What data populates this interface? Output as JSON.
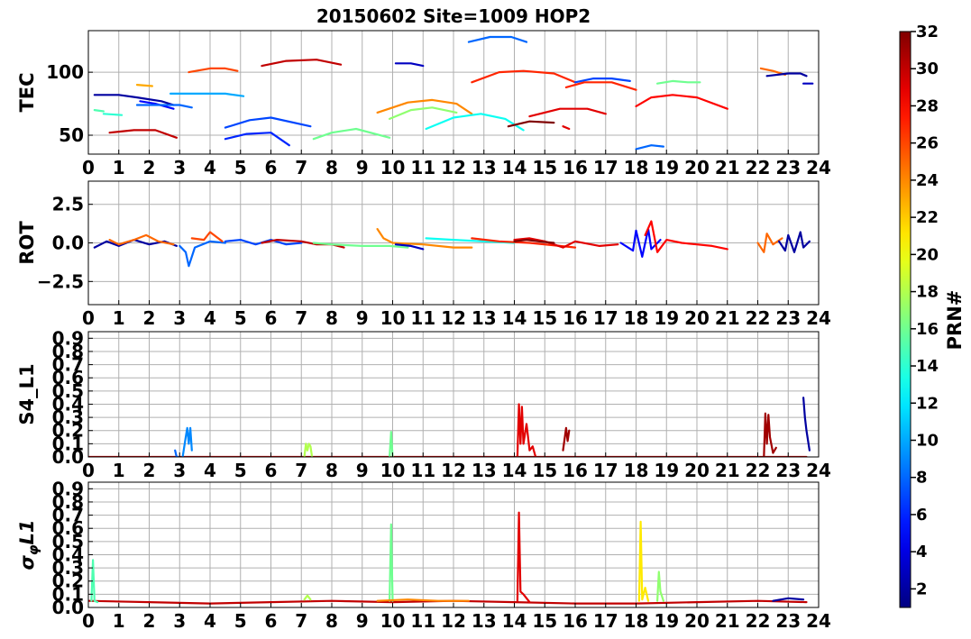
{
  "figure": {
    "title": "20150602 Site=1009 HOP2"
  },
  "colorbar": {
    "label": "PRN#",
    "ticks": [
      "2",
      "4",
      "6",
      "8",
      "10",
      "12",
      "14",
      "16",
      "18",
      "20",
      "22",
      "24",
      "26",
      "28",
      "30",
      "32"
    ],
    "range": [
      1,
      32
    ],
    "colormap": "jet"
  },
  "chart_data": [
    {
      "type": "line",
      "ylabel": "TEC",
      "xlim": [
        0,
        24
      ],
      "ylim": [
        35,
        133
      ],
      "xticks": [
        0,
        1,
        2,
        3,
        4,
        5,
        6,
        7,
        8,
        9,
        10,
        11,
        12,
        13,
        14,
        15,
        16,
        17,
        18,
        19,
        20,
        21,
        22,
        23,
        24
      ],
      "yticks": [
        50,
        100
      ],
      "grid": true,
      "series": [
        {
          "prn": 2,
          "x": [
            0.2,
            1.0,
            1.6,
            2.4,
            2.8
          ],
          "y": [
            82,
            82,
            80,
            77,
            74
          ]
        },
        {
          "prn": 5,
          "x": [
            1.7,
            2.2,
            2.8
          ],
          "y": [
            77,
            75,
            71
          ]
        },
        {
          "prn": 8,
          "x": [
            1.6,
            2.5,
            3.0,
            3.4
          ],
          "y": [
            74,
            74,
            74,
            72
          ]
        },
        {
          "prn": 10,
          "x": [
            2.7,
            3.2,
            4.5,
            5.1
          ],
          "y": [
            83,
            83,
            83,
            81
          ]
        },
        {
          "prn": 15,
          "x": [
            0.2,
            0.5
          ],
          "y": [
            70,
            69
          ]
        },
        {
          "prn": 14,
          "x": [
            0.5,
            1.1
          ],
          "y": [
            67,
            66
          ]
        },
        {
          "prn": 30,
          "x": [
            0.7,
            1.5,
            2.2,
            2.9
          ],
          "y": [
            52,
            54,
            54,
            48
          ]
        },
        {
          "prn": 23,
          "x": [
            1.6,
            2.1
          ],
          "y": [
            90,
            89
          ]
        },
        {
          "prn": 26,
          "x": [
            3.3,
            4.0,
            4.5,
            4.9
          ],
          "y": [
            100,
            103,
            103,
            101
          ]
        },
        {
          "prn": 7,
          "x": [
            4.5,
            5.3,
            6.0,
            7.3
          ],
          "y": [
            56,
            62,
            64,
            57
          ]
        },
        {
          "prn": 6,
          "x": [
            4.5,
            5.2,
            6.0,
            6.6
          ],
          "y": [
            47,
            51,
            52,
            42
          ]
        },
        {
          "prn": 30,
          "x": [
            5.7,
            6.5,
            7.5,
            8.3
          ],
          "y": [
            105,
            109,
            110,
            106
          ]
        },
        {
          "prn": 16,
          "x": [
            7.4,
            8.0,
            8.8,
            9.9
          ],
          "y": [
            47,
            52,
            55,
            48
          ]
        },
        {
          "prn": 3,
          "x": [
            10.1,
            10.6,
            11.0
          ],
          "y": [
            107,
            107,
            105
          ]
        },
        {
          "prn": 24,
          "x": [
            9.5,
            10.5,
            11.3,
            12.1,
            12.6
          ],
          "y": [
            68,
            76,
            78,
            75,
            67
          ]
        },
        {
          "prn": 17,
          "x": [
            9.9,
            10.6,
            11.3,
            12.1
          ],
          "y": [
            63,
            70,
            72,
            68
          ]
        },
        {
          "prn": 13,
          "x": [
            11.1,
            12.0,
            12.9,
            13.7,
            14.3
          ],
          "y": [
            55,
            64,
            67,
            63,
            54
          ]
        },
        {
          "prn": 8,
          "x": [
            12.5,
            13.2,
            13.9,
            14.4
          ],
          "y": [
            124,
            128,
            128,
            124
          ]
        },
        {
          "prn": 27,
          "x": [
            12.6,
            13.5,
            14.3,
            15.3,
            16.0
          ],
          "y": [
            92,
            100,
            101,
            99,
            92
          ]
        },
        {
          "prn": 32,
          "x": [
            13.8,
            14.5,
            15.3
          ],
          "y": [
            57,
            61,
            60
          ]
        },
        {
          "prn": 29,
          "x": [
            14.5,
            15.5,
            16.4,
            17.0
          ],
          "y": [
            65,
            71,
            71,
            67
          ]
        },
        {
          "prn": 29,
          "x": [
            15.6,
            15.8
          ],
          "y": [
            57,
            55
          ]
        },
        {
          "prn": 7,
          "x": [
            16.0,
            16.6,
            17.2,
            17.8
          ],
          "y": [
            92,
            95,
            95,
            93
          ]
        },
        {
          "prn": 27,
          "x": [
            15.7,
            16.3,
            17.2,
            18.0
          ],
          "y": [
            88,
            92,
            92,
            86
          ]
        },
        {
          "prn": 28,
          "x": [
            18.0,
            18.5,
            19.2,
            20.0,
            21.0
          ],
          "y": [
            73,
            80,
            82,
            80,
            71
          ]
        },
        {
          "prn": 8,
          "x": [
            18.0,
            18.5,
            18.9
          ],
          "y": [
            39,
            42,
            41
          ]
        },
        {
          "prn": 16,
          "x": [
            18.7,
            19.2,
            19.7,
            20.1
          ],
          "y": [
            91,
            93,
            92,
            92
          ]
        },
        {
          "prn": 25,
          "x": [
            22.1,
            22.5,
            22.9
          ],
          "y": [
            103,
            101,
            98
          ]
        },
        {
          "prn": 2,
          "x": [
            22.3,
            23.0,
            23.4,
            23.6
          ],
          "y": [
            97,
            99,
            99,
            97
          ]
        },
        {
          "prn": 3,
          "x": [
            23.5,
            23.8
          ],
          "y": [
            91,
            91
          ]
        }
      ]
    },
    {
      "type": "line",
      "ylabel": "ROT",
      "xlim": [
        0,
        24
      ],
      "ylim": [
        -4,
        4
      ],
      "xticks": [
        0,
        1,
        2,
        3,
        4,
        5,
        6,
        7,
        8,
        9,
        10,
        11,
        12,
        13,
        14,
        15,
        16,
        17,
        18,
        19,
        20,
        21,
        22,
        23,
        24
      ],
      "yticks": [
        -2.5,
        0.0,
        2.5
      ],
      "grid": true,
      "series": [
        {
          "prn": 2,
          "x": [
            0.2,
            0.6,
            1.0,
            1.5,
            2.0,
            2.5,
            2.9
          ],
          "y": [
            -0.3,
            0.1,
            -0.2,
            0.2,
            -0.1,
            0.1,
            -0.2
          ]
        },
        {
          "prn": 25,
          "x": [
            0.7,
            1.0,
            1.5,
            1.9,
            2.3,
            2.8
          ],
          "y": [
            0.2,
            -0.1,
            0.2,
            0.5,
            0.1,
            -0.1
          ]
        },
        {
          "prn": 8,
          "x": [
            3.0,
            3.2,
            3.3,
            3.5,
            4.0,
            4.5
          ],
          "y": [
            -0.2,
            -0.6,
            -1.5,
            -0.3,
            0.1,
            0.0
          ]
        },
        {
          "prn": 26,
          "x": [
            3.4,
            3.8,
            4.0,
            4.4
          ],
          "y": [
            0.3,
            0.2,
            0.7,
            0.1
          ]
        },
        {
          "prn": 7,
          "x": [
            4.5,
            5.0,
            5.5,
            6.0,
            6.5,
            7.0
          ],
          "y": [
            0.1,
            0.2,
            -0.1,
            0.2,
            -0.1,
            0.0
          ]
        },
        {
          "prn": 30,
          "x": [
            5.7,
            6.2,
            7.0,
            7.5,
            8.0,
            8.4
          ],
          "y": [
            0.0,
            0.2,
            0.1,
            -0.1,
            -0.1,
            -0.3
          ]
        },
        {
          "prn": 16,
          "x": [
            7.4,
            8.0,
            9.0,
            9.9,
            10.5
          ],
          "y": [
            0.0,
            -0.1,
            -0.2,
            -0.2,
            -0.3
          ]
        },
        {
          "prn": 24,
          "x": [
            9.5,
            9.7,
            10.0,
            11.0,
            12.0,
            12.6
          ],
          "y": [
            0.9,
            0.3,
            0.0,
            -0.1,
            -0.3,
            -0.3
          ]
        },
        {
          "prn": 3,
          "x": [
            10.1,
            10.6,
            11.0
          ],
          "y": [
            -0.1,
            -0.2,
            -0.4
          ]
        },
        {
          "prn": 13,
          "x": [
            11.1,
            12.0,
            13.0,
            14.0
          ],
          "y": [
            0.3,
            0.2,
            0.1,
            0.0
          ]
        },
        {
          "prn": 27,
          "x": [
            12.6,
            13.5,
            14.5,
            15.5,
            16.0
          ],
          "y": [
            0.3,
            0.1,
            0.0,
            -0.2,
            -0.3
          ]
        },
        {
          "prn": 29,
          "x": [
            14.0,
            14.5,
            15.0,
            15.6,
            16.0,
            16.8,
            17.4
          ],
          "y": [
            0.2,
            0.3,
            0.1,
            -0.3,
            0.1,
            -0.2,
            -0.1
          ]
        },
        {
          "prn": 32,
          "x": [
            14.0,
            14.4,
            14.8,
            15.3
          ],
          "y": [
            0.1,
            0.2,
            0.1,
            0.0
          ]
        },
        {
          "prn": 5,
          "x": [
            17.5,
            17.9,
            18.0,
            18.2,
            18.4,
            18.5,
            18.8
          ],
          "y": [
            0.0,
            -0.5,
            0.8,
            -0.9,
            0.9,
            -0.4,
            0.2
          ]
        },
        {
          "prn": 28,
          "x": [
            18.3,
            18.5,
            18.7,
            19.0,
            19.5,
            20.0,
            20.5,
            21.0
          ],
          "y": [
            0.5,
            1.4,
            -0.6,
            0.2,
            0.0,
            -0.1,
            -0.2,
            -0.4
          ]
        },
        {
          "prn": 25,
          "x": [
            22.0,
            22.2,
            22.3,
            22.5,
            22.8
          ],
          "y": [
            0.0,
            -0.6,
            0.6,
            -0.1,
            0.3
          ]
        },
        {
          "prn": 2,
          "x": [
            22.7,
            22.9,
            23.0,
            23.2,
            23.4,
            23.5,
            23.7
          ],
          "y": [
            0.1,
            -0.5,
            0.5,
            -0.6,
            0.7,
            -0.3,
            0.1
          ]
        }
      ]
    },
    {
      "type": "line",
      "ylabel": "S4_L1",
      "xlim": [
        0,
        24
      ],
      "ylim": [
        0,
        0.95
      ],
      "xticks": [
        0,
        1,
        2,
        3,
        4,
        5,
        6,
        7,
        8,
        9,
        10,
        11,
        12,
        13,
        14,
        15,
        16,
        17,
        18,
        19,
        20,
        21,
        22,
        23,
        24
      ],
      "yticks": [
        0.0,
        0.1,
        0.2,
        0.3,
        0.4,
        0.5,
        0.6,
        0.7,
        0.8,
        0.9
      ],
      "grid": true,
      "series": [
        {
          "prn": 30,
          "x": [
            0.0,
            3.0,
            6.0,
            9.0,
            12.0,
            15.0,
            18.0,
            21.0,
            23.6
          ],
          "y": [
            0.0,
            0.0,
            0.0,
            0.0,
            0.0,
            0.0,
            0.0,
            0.0,
            0.0
          ]
        },
        {
          "prn": 8,
          "x": [
            2.85,
            2.9,
            2.95
          ],
          "y": [
            0.05,
            0.0,
            0.0
          ]
        },
        {
          "prn": 9,
          "x": [
            3.1,
            3.2,
            3.25,
            3.3,
            3.35,
            3.4
          ],
          "y": [
            0.0,
            0.15,
            0.22,
            0.1,
            0.22,
            0.05
          ]
        },
        {
          "prn": 18,
          "x": [
            7.1,
            7.15,
            7.2,
            7.25,
            7.3,
            7.35
          ],
          "y": [
            0.0,
            0.1,
            0.05,
            0.1,
            0.08,
            0.0
          ]
        },
        {
          "prn": 16,
          "x": [
            9.9,
            9.95,
            10.0
          ],
          "y": [
            0.0,
            0.19,
            0.0
          ]
        },
        {
          "prn": 29,
          "x": [
            14.1,
            14.15,
            14.2,
            14.25,
            14.3,
            14.4,
            14.5,
            14.6,
            14.7
          ],
          "y": [
            0.0,
            0.4,
            0.1,
            0.38,
            0.1,
            0.25,
            0.05,
            0.08,
            0.0
          ]
        },
        {
          "prn": 31,
          "x": [
            15.6,
            15.7,
            15.75,
            15.8
          ],
          "y": [
            0.05,
            0.22,
            0.12,
            0.2
          ]
        },
        {
          "prn": 31,
          "x": [
            22.2,
            22.25,
            22.3,
            22.35,
            22.4,
            22.5,
            22.6
          ],
          "y": [
            0.0,
            0.33,
            0.1,
            0.32,
            0.15,
            0.03,
            0.07
          ]
        },
        {
          "prn": 2,
          "x": [
            23.5,
            23.55,
            23.6,
            23.7
          ],
          "y": [
            0.45,
            0.3,
            0.2,
            0.05
          ]
        }
      ]
    },
    {
      "type": "line",
      "ylabel": "σ_φL1",
      "xlim": [
        0,
        24
      ],
      "ylim": [
        0,
        0.95
      ],
      "xticks": [
        0,
        1,
        2,
        3,
        4,
        5,
        6,
        7,
        8,
        9,
        10,
        11,
        12,
        13,
        14,
        15,
        16,
        17,
        18,
        19,
        20,
        21,
        22,
        23,
        24
      ],
      "yticks": [
        0.0,
        0.1,
        0.2,
        0.3,
        0.4,
        0.5,
        0.6,
        0.7,
        0.8,
        0.9
      ],
      "grid": true,
      "series": [
        {
          "prn": 30,
          "x": [
            0.0,
            2.0,
            4.0,
            6.0,
            8.0,
            10.0,
            12.0,
            14.0,
            16.0,
            18.0,
            20.0,
            22.0,
            23.6
          ],
          "y": [
            0.05,
            0.04,
            0.03,
            0.04,
            0.05,
            0.04,
            0.05,
            0.04,
            0.03,
            0.03,
            0.04,
            0.05,
            0.04
          ]
        },
        {
          "prn": 15,
          "x": [
            0.1,
            0.15,
            0.2,
            0.3
          ],
          "y": [
            0.05,
            0.36,
            0.05,
            0.04
          ]
        },
        {
          "prn": 16,
          "x": [
            9.9,
            9.95,
            10.0
          ],
          "y": [
            0.05,
            0.63,
            0.05
          ]
        },
        {
          "prn": 29,
          "x": [
            14.1,
            14.15,
            14.2,
            14.3,
            14.5
          ],
          "y": [
            0.05,
            0.72,
            0.12,
            0.1,
            0.04
          ]
        },
        {
          "prn": 21,
          "x": [
            18.1,
            18.15,
            18.2,
            18.3,
            18.4
          ],
          "y": [
            0.05,
            0.65,
            0.06,
            0.15,
            0.05
          ]
        },
        {
          "prn": 17,
          "x": [
            18.7,
            18.75,
            18.8,
            18.9
          ],
          "y": [
            0.05,
            0.27,
            0.12,
            0.05
          ]
        },
        {
          "prn": 18,
          "x": [
            7.1,
            7.2,
            7.3
          ],
          "y": [
            0.06,
            0.09,
            0.06
          ]
        },
        {
          "prn": 2,
          "x": [
            22.5,
            23.0,
            23.5
          ],
          "y": [
            0.05,
            0.07,
            0.06
          ]
        },
        {
          "prn": 24,
          "x": [
            9.5,
            10.5,
            11.5,
            12.5
          ],
          "y": [
            0.05,
            0.06,
            0.05,
            0.05
          ]
        }
      ]
    }
  ]
}
